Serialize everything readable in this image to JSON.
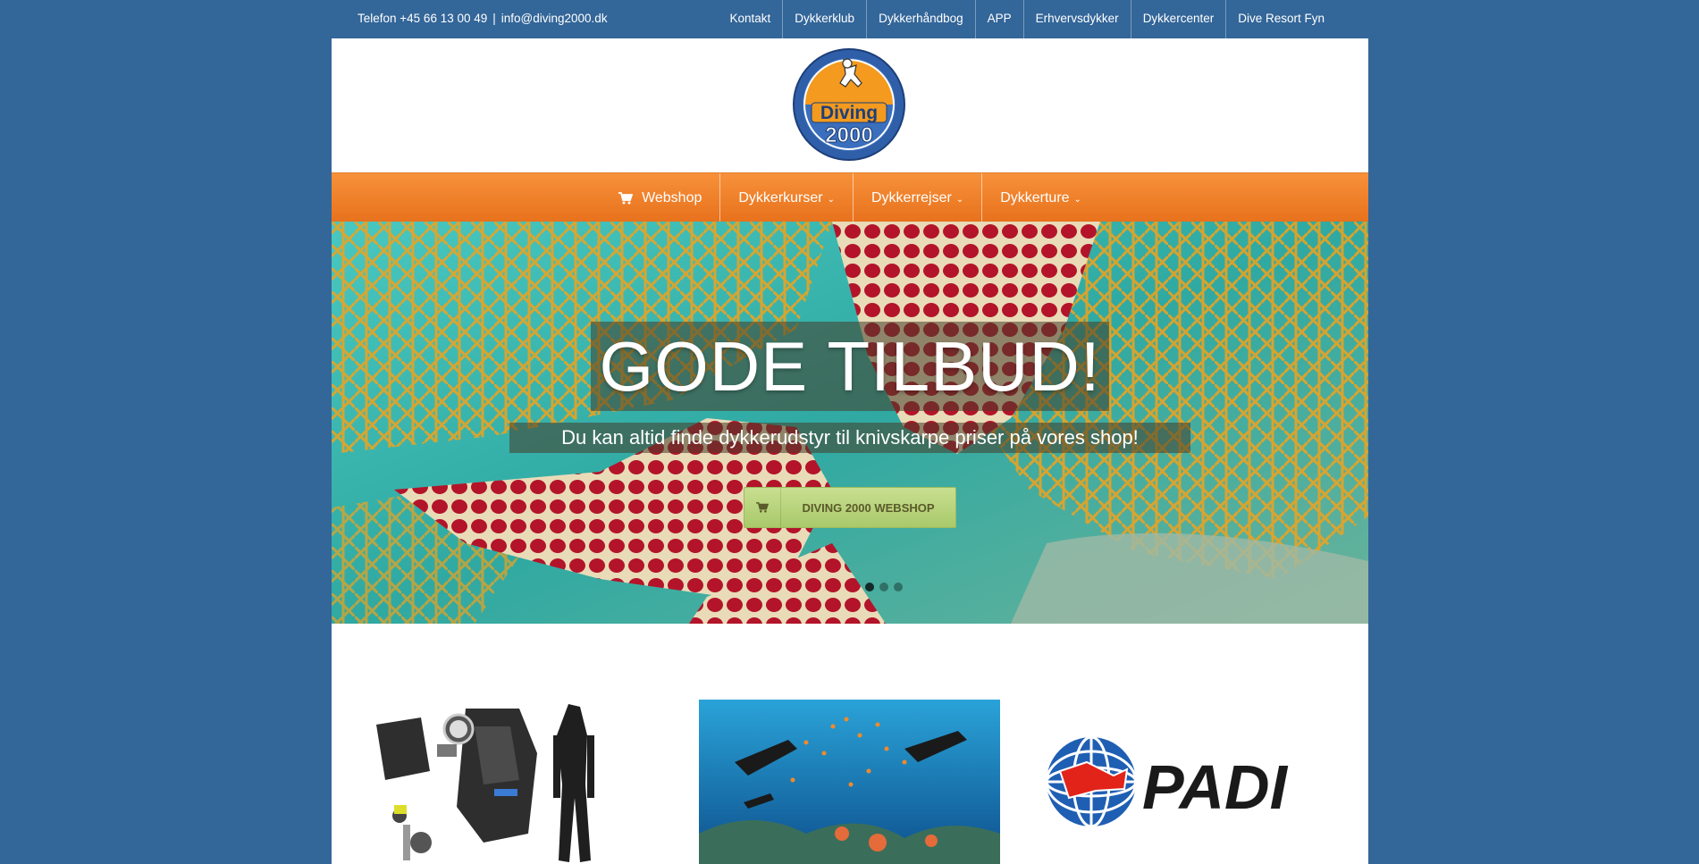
{
  "topbar": {
    "phone": "Telefon +45 66 13 00 49",
    "separator": "|",
    "email": "info@diving2000.dk",
    "links": [
      "Kontakt",
      "Dykkerklub",
      "Dykkerhåndbog",
      "APP",
      "Erhvervsdykker",
      "Dykkercenter",
      "Dive Resort Fyn"
    ]
  },
  "logo": {
    "text": "Diving",
    "number": "2000"
  },
  "mainnav": {
    "webshop": "Webshop",
    "kurser": "Dykkerkurser",
    "rejser": "Dykkerrejser",
    "ture": "Dykkerture"
  },
  "hero": {
    "headline": "GODE TILBUD!",
    "subtitle": "Du kan altid finde dykkerudstyr til knivskarpe priser på vores shop!",
    "cta": "DIVING 2000 WEBSHOP",
    "slides": 3,
    "active_slide": 1
  },
  "promos": {
    "padi_text": "PADI"
  },
  "colors": {
    "background": "#336699",
    "nav_orange": "#ef8329",
    "cta_green": "#b9d57c"
  }
}
